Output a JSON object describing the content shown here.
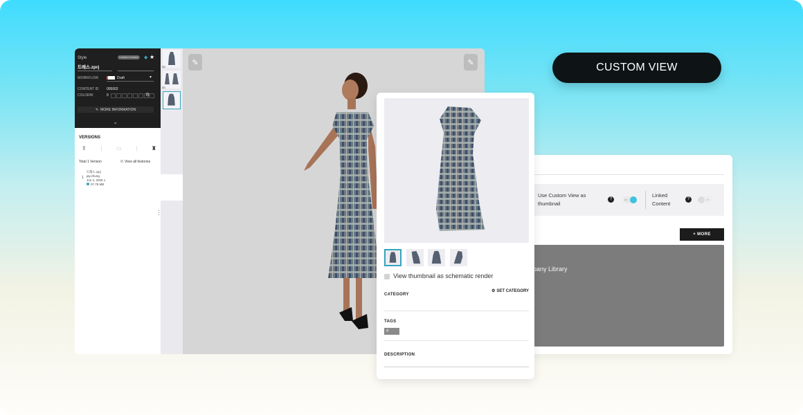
{
  "custom_view_label": "CUSTOM VIEW",
  "app": {
    "style_label": "Style",
    "badge": "Linked Content",
    "file_name": "드레스.zprj",
    "workflow_label": "WORKFLOW",
    "workflow_value": "Draft",
    "content_id_label": "CONTENT ID",
    "content_id_value": "005002",
    "colorway_label": "COLORW",
    "colorway_value": "0",
    "more_info_label": "MORE INFORMATION",
    "versions_title": "VERSIONS",
    "total_versions": "Total 1 Version",
    "view_all": "View all histories",
    "version_number": "1",
    "version_file": "드레스.zprj",
    "version_author": "jay.chung",
    "version_date": "Jun 2, 2025 1",
    "version_size": "07.78 MB",
    "thumb_labels": [
      "3D",
      "2D"
    ]
  },
  "panel": {
    "schematic_label": "View thumbnail as schematic render",
    "category_title": "CATEGORY",
    "set_category": "SET CATEGORY",
    "tags_title": "TAGS",
    "tag_chip": "#",
    "description_title": "DESCRIPTION"
  },
  "right_panel": {
    "use_custom_view": "Use Custom View as thumbnail",
    "use_custom_view_state": "on",
    "linked_content": "Linked Content",
    "linked_content_state": "off",
    "more_button": "+ MORE",
    "library_text": "pany Library"
  },
  "colors": {
    "accent": "#35a3bc",
    "dark": "#1f1f1f",
    "pill": "#0e1416"
  }
}
